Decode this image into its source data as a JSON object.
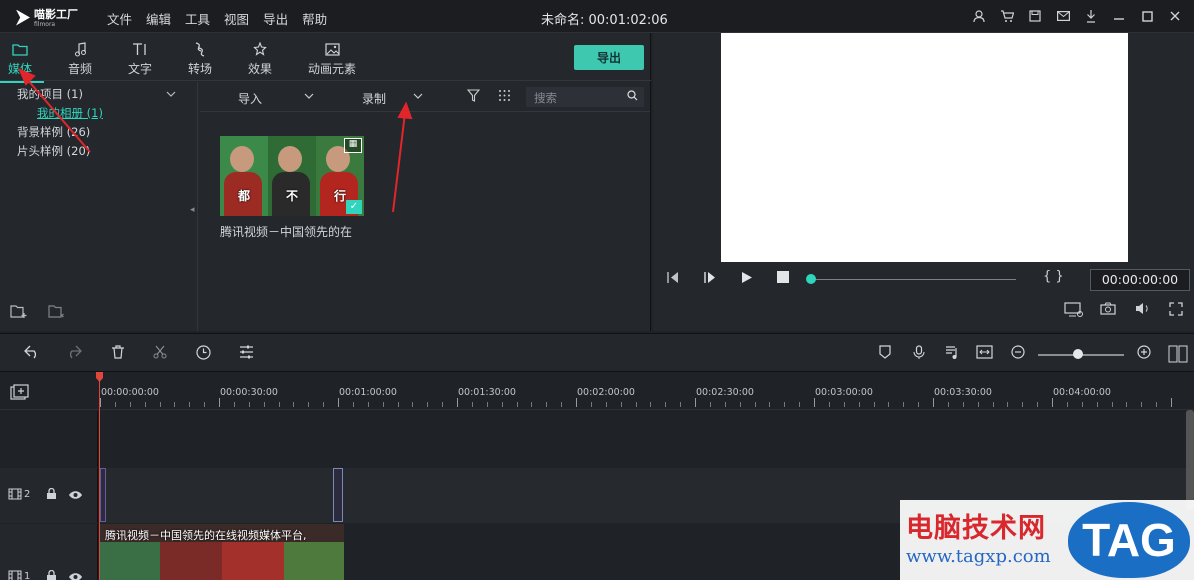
{
  "app": {
    "logo_text": "喵影工厂",
    "logo_sub": "filmora",
    "menu": [
      "文件",
      "编辑",
      "工具",
      "视图",
      "导出",
      "帮助"
    ],
    "project_title": "未命名: 00:01:02:06"
  },
  "window_icons": [
    "account-icon",
    "cart-icon",
    "save-icon",
    "mail-icon",
    "download-icon",
    "minimize-icon",
    "maximize-icon",
    "close-icon"
  ],
  "category_tabs": [
    {
      "label": "媒体",
      "icon": "folder-icon",
      "active": true
    },
    {
      "label": "音频",
      "icon": "music-note-icon",
      "active": false
    },
    {
      "label": "文字",
      "icon": "text-icon",
      "active": false
    },
    {
      "label": "转场",
      "icon": "transition-icon",
      "active": false
    },
    {
      "label": "效果",
      "icon": "effects-icon",
      "active": false
    },
    {
      "label": "动画元素",
      "icon": "image-icon",
      "active": false
    }
  ],
  "export_label": "导出",
  "tree": {
    "my_project": "我的项目 (1)",
    "my_album": "我的相册 (1)",
    "bg_samples": "背景样例 (26)",
    "intro_samples": "片头样例 (20)"
  },
  "media_toolbar": {
    "import_label": "导入",
    "record_label": "录制",
    "search_placeholder": "搜索"
  },
  "media_item": {
    "label": "腾讯视频－中国领先的在",
    "captions": [
      "都",
      "不",
      "行"
    ]
  },
  "preview": {
    "timecode": "00:00:00:00",
    "bracket_label": "{ }"
  },
  "ruler_labels": [
    "00:00:00:00",
    "00:00:30:00",
    "00:01:00:00",
    "00:01:30:00",
    "00:02:00:00",
    "00:02:30:00",
    "00:03:00:00",
    "00:03:30:00",
    "00:04:00:00"
  ],
  "tracks": [
    {
      "number": "2"
    },
    {
      "number": "1"
    }
  ],
  "video_clip_title": "腾讯视频－中国领先的在线视频媒体平台,",
  "watermark": {
    "cn": "电脑技术网",
    "url": "www.tagxp.com",
    "tag": "TAG"
  },
  "colors": {
    "accent": "#2fd6bd",
    "export_button": "#3ec8b0",
    "annotation_arrow": "#e0262b",
    "playhead": "#e0473b"
  }
}
